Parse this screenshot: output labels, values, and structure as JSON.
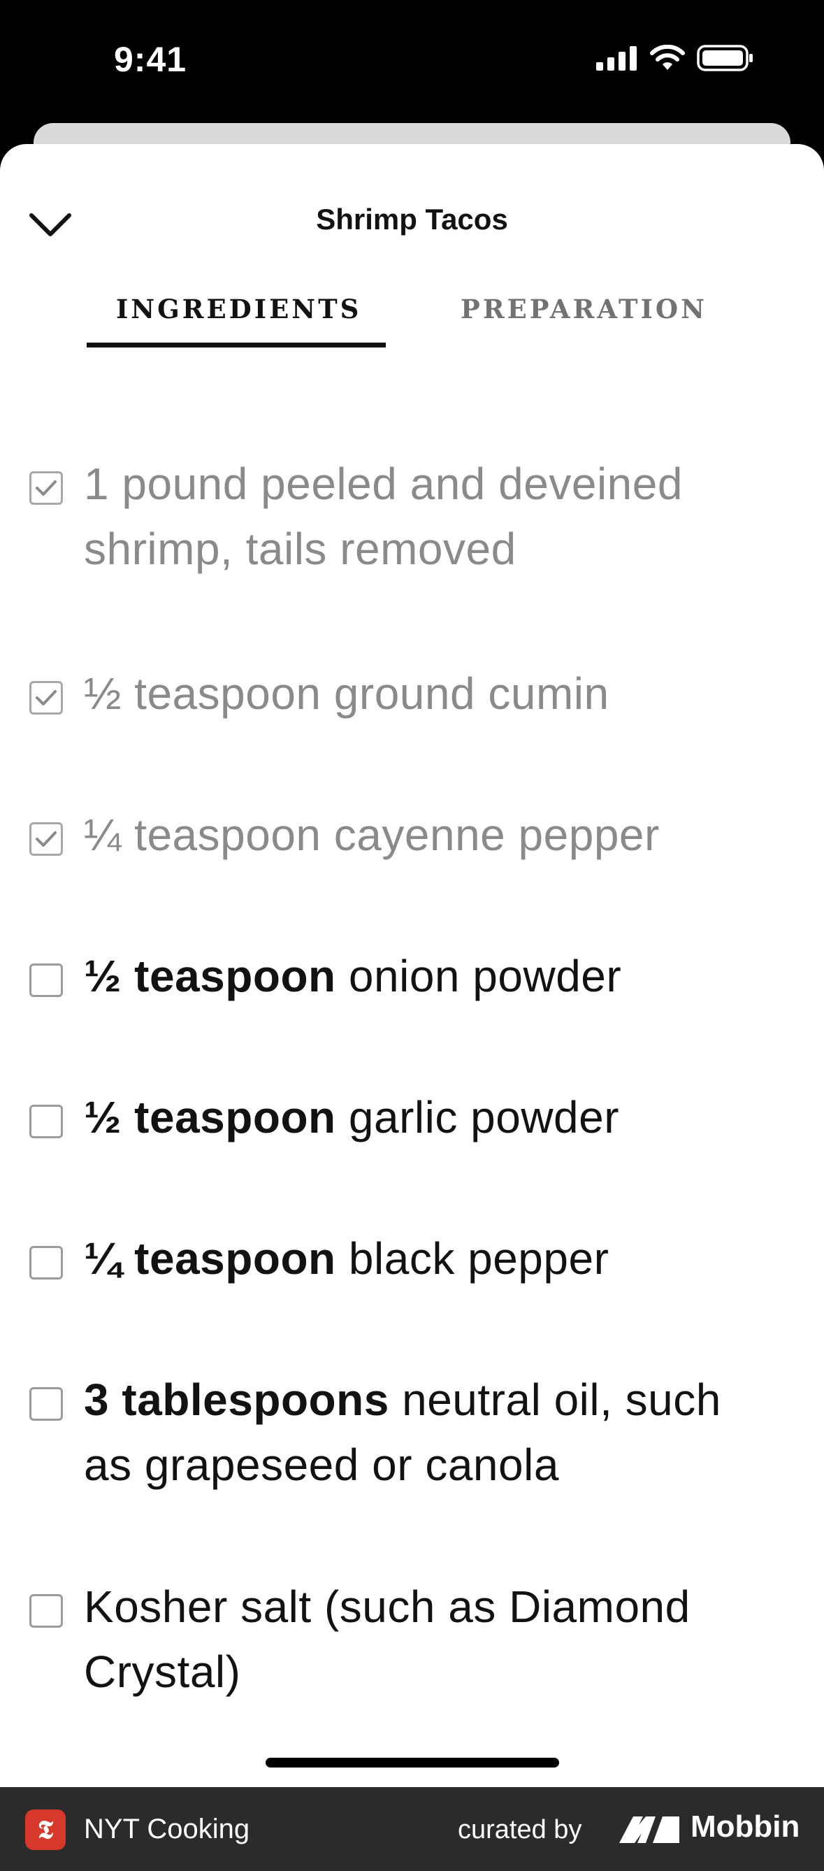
{
  "status_bar": {
    "time": "9:41"
  },
  "header": {
    "title": "Shrimp Tacos"
  },
  "tabs": [
    {
      "label": "INGREDIENTS",
      "active": true
    },
    {
      "label": "PREPARATION",
      "active": false
    }
  ],
  "ingredients": [
    {
      "qty": "",
      "rest_line1": "1 pound peeled and deveined",
      "rest_line2": "shrimp, tails removed",
      "checked": true
    },
    {
      "qty": "",
      "rest_line1": "½ teaspoon ground cumin",
      "rest_line2": "",
      "checked": true
    },
    {
      "qty": "",
      "rest_line1": "¼ teaspoon cayenne pepper",
      "rest_line2": "",
      "checked": true
    },
    {
      "qty": "½ teaspoon",
      "rest_line1": " onion powder",
      "rest_line2": "",
      "checked": false
    },
    {
      "qty": "½ teaspoon",
      "rest_line1": " garlic powder",
      "rest_line2": "",
      "checked": false
    },
    {
      "qty": "¼ teaspoon",
      "rest_line1": " black pepper",
      "rest_line2": "",
      "checked": false
    },
    {
      "qty": "3 tablespoons",
      "rest_line1": " neutral oil, such",
      "rest_line2": "as grapeseed or canola",
      "checked": false
    },
    {
      "qty": "",
      "rest_line1": "Kosher salt (such as Diamond",
      "rest_line2": "Crystal)",
      "checked": false
    }
  ],
  "footer": {
    "app_name": "NYT Cooking",
    "curated_label": "curated by",
    "brand": "Mobbin"
  },
  "colors": {
    "text": "#121212",
    "muted": "#8a8a8a",
    "nyt_red": "#d6392b",
    "footer_bg": "#2b2b2b"
  }
}
